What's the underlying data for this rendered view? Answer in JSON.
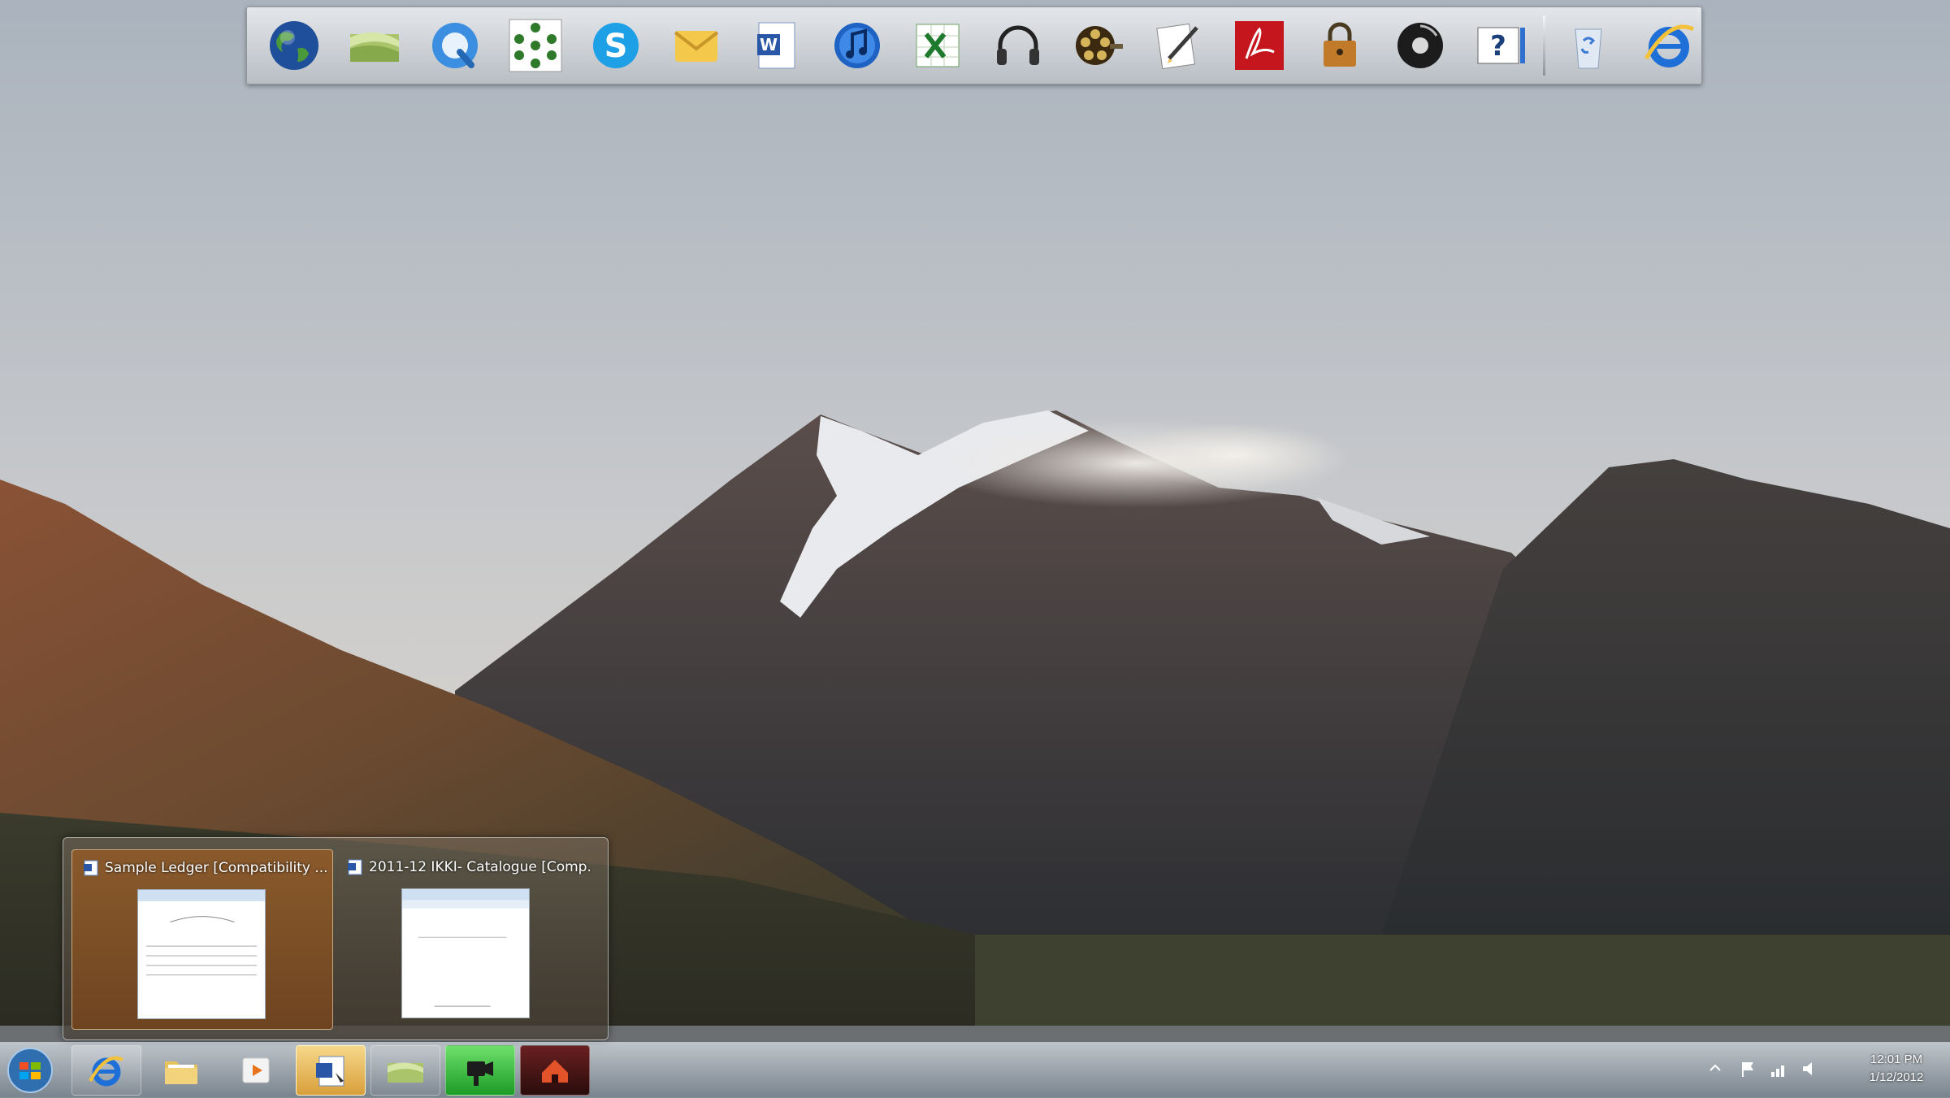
{
  "desktop": {
    "wallpaper": "mountain-lake-landscape"
  },
  "dock": {
    "items": [
      {
        "name": "globe-icon"
      },
      {
        "name": "green-folder-icon"
      },
      {
        "name": "quicktime-icon"
      },
      {
        "name": "network-graph-icon"
      },
      {
        "name": "skype-icon",
        "label": "S"
      },
      {
        "name": "mail-envelope-icon"
      },
      {
        "name": "word-document-icon",
        "label": "W"
      },
      {
        "name": "itunes-icon"
      },
      {
        "name": "excel-spreadsheet-icon"
      },
      {
        "name": "headphones-icon"
      },
      {
        "name": "film-reel-icon"
      },
      {
        "name": "notes-pen-icon"
      },
      {
        "name": "adobe-reader-icon"
      },
      {
        "name": "padlock-icon"
      },
      {
        "name": "media-disc-icon"
      },
      {
        "name": "help-icon",
        "label": "?"
      },
      {
        "name": "recycle-bin-icon"
      },
      {
        "name": "internet-explorer-icon"
      }
    ]
  },
  "thumbnail_popup": {
    "windows": [
      {
        "title": "Sample Ledger [Compatibility ...",
        "active": true
      },
      {
        "title": "2011-12 IKKI- Catalogue [Comp...",
        "active": false
      }
    ]
  },
  "taskbar": {
    "start_icon": "windows-start-orb",
    "buttons": [
      {
        "name": "internet-explorer-taskbar-icon"
      },
      {
        "name": "folder-taskbar-icon"
      },
      {
        "name": "media-player-taskbar-icon"
      },
      {
        "name": "word-taskbar-icon"
      },
      {
        "name": "green-folder-taskbar-icon"
      },
      {
        "name": "camtasia-recorder-taskbar-icon"
      },
      {
        "name": "home-app-taskbar-icon"
      }
    ],
    "clock": {
      "time": "12:01 PM",
      "date": "1/12/2012"
    }
  }
}
